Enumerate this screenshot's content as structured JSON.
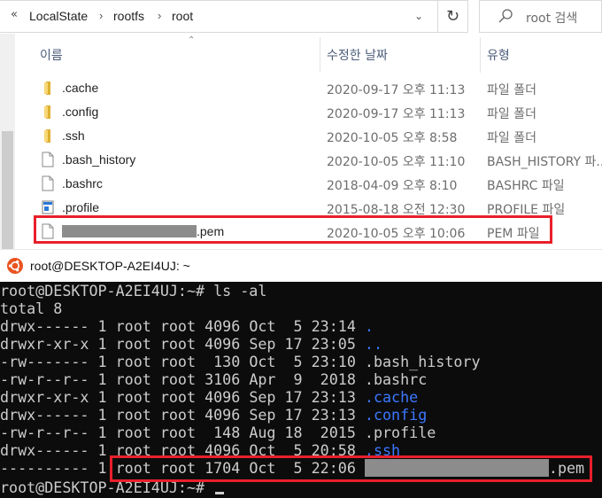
{
  "explorer": {
    "breadcrumb": {
      "overflow": "«",
      "items": [
        "LocalState",
        "rootfs",
        "root"
      ],
      "separator": "›"
    },
    "search": {
      "placeholder": "root 검색"
    },
    "columns": {
      "name": "이름",
      "date": "수정한 날짜",
      "type": "유형"
    },
    "files": [
      {
        "name": ".cache",
        "date": "2020-09-17 오후 11:13",
        "type": "파일 폴더",
        "icon": "folder-icon"
      },
      {
        "name": ".config",
        "date": "2020-09-17 오후 11:13",
        "type": "파일 폴더",
        "icon": "folder-icon"
      },
      {
        "name": ".ssh",
        "date": "2020-10-05 오후 8:58",
        "type": "파일 폴더",
        "icon": "folder-icon"
      },
      {
        "name": ".bash_history",
        "date": "2020-10-05 오후 11:10",
        "type": "BASH_HISTORY 파...",
        "icon": "file-icon"
      },
      {
        "name": ".bashrc",
        "date": "2018-04-09 오후 8:10",
        "type": "BASHRC 파일",
        "icon": "file-icon"
      },
      {
        "name": ".profile",
        "date": "2015-08-18 오전 12:30",
        "type": "PROFILE 파일",
        "icon": "profile-file-icon"
      },
      {
        "name": ".pem",
        "date": "2020-10-05 오후 10:06",
        "type": "PEM 파일",
        "icon": "file-icon"
      }
    ],
    "highlight_color": "#e8202a"
  },
  "terminal": {
    "title": "root@DESKTOP-A2EI4UJ: ~",
    "prompt": "root@DESKTOP-A2EI4UJ:~#",
    "command": "ls -al",
    "total": "total 8",
    "entries": [
      {
        "perms": "drwx------",
        "links": "1",
        "owner": "root",
        "group": "root",
        "size": "4096",
        "month": "Oct",
        "day": " 5",
        "time": "23:14",
        "name": ".",
        "is_dir": true
      },
      {
        "perms": "drwxr-xr-x",
        "links": "1",
        "owner": "root",
        "group": "root",
        "size": "4096",
        "month": "Sep",
        "day": "17",
        "time": "23:05",
        "name": "..",
        "is_dir": true
      },
      {
        "perms": "-rw-------",
        "links": "1",
        "owner": "root",
        "group": "root",
        "size": " 130",
        "month": "Oct",
        "day": " 5",
        "time": "23:10",
        "name": ".bash_history",
        "is_dir": false
      },
      {
        "perms": "-rw-r--r--",
        "links": "1",
        "owner": "root",
        "group": "root",
        "size": "3106",
        "month": "Apr",
        "day": " 9",
        "time": " 2018",
        "name": ".bashrc",
        "is_dir": false
      },
      {
        "perms": "drwxr-xr-x",
        "links": "1",
        "owner": "root",
        "group": "root",
        "size": "4096",
        "month": "Sep",
        "day": "17",
        "time": "23:13",
        "name": ".cache",
        "is_dir": true
      },
      {
        "perms": "drwx------",
        "links": "1",
        "owner": "root",
        "group": "root",
        "size": "4096",
        "month": "Sep",
        "day": "17",
        "time": "23:13",
        "name": ".config",
        "is_dir": true
      },
      {
        "perms": "-rw-r--r--",
        "links": "1",
        "owner": "root",
        "group": "root",
        "size": " 148",
        "month": "Aug",
        "day": "18",
        "time": " 2015",
        "name": ".profile",
        "is_dir": false
      },
      {
        "perms": "drwx------",
        "links": "1",
        "owner": "root",
        "group": "root",
        "size": "4096",
        "month": "Oct",
        "day": " 5",
        "time": "20:58",
        "name": ".ssh",
        "is_dir": true
      }
    ],
    "pem_entry": {
      "perms": "----------",
      "links": "1",
      "owner": "root",
      "group": "root",
      "size": "1704",
      "month": "Oct",
      "day": " 5",
      "time": "22:06",
      "name": ".pem"
    },
    "colors": {
      "background": "#0c0c0c",
      "text": "#cccccc",
      "dir": "#3b78ff"
    }
  }
}
